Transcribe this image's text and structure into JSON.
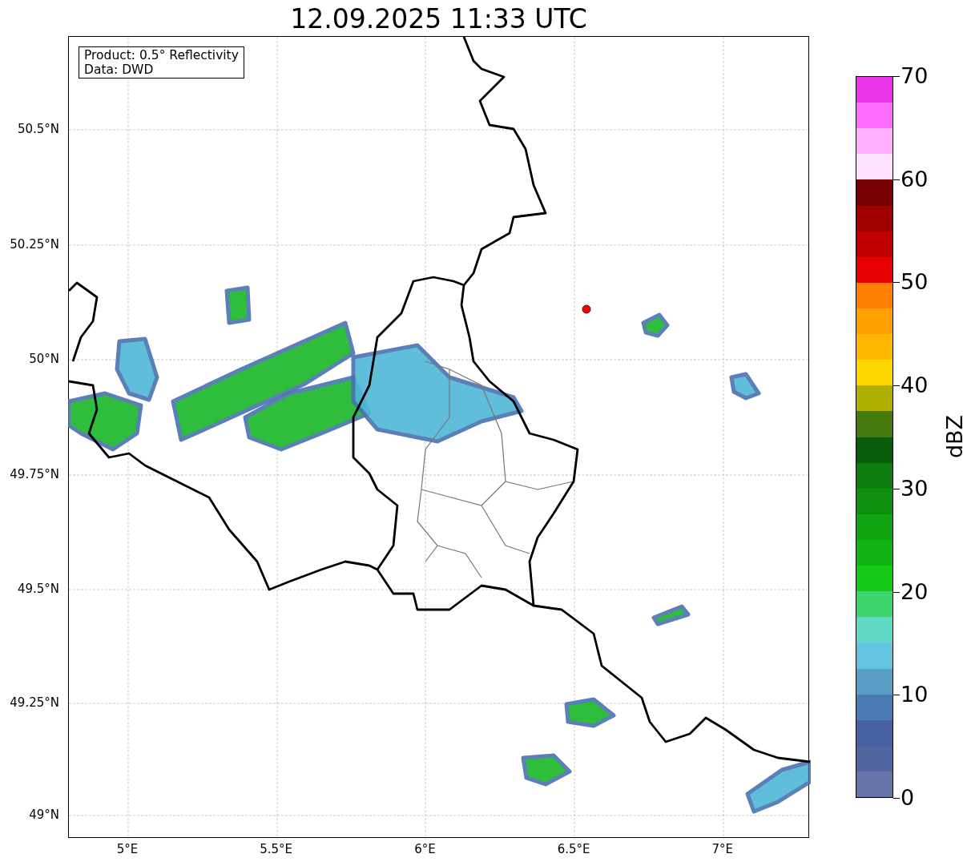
{
  "title": "12.09.2025 11:33 UTC",
  "map": {
    "legend": [
      "Product: 0.5° Reflectivity",
      "Data: DWD"
    ],
    "lat_labels": [
      "50.5°N",
      "50.25°N",
      "50°N",
      "49.75°N",
      "49.5°N",
      "49.25°N",
      "49°N"
    ],
    "lon_labels": [
      "5°E",
      "5.5°E",
      "6°E",
      "6.5°E",
      "7°E"
    ]
  },
  "colorbar": {
    "label": "dBZ",
    "ticks": [
      "70",
      "60",
      "50",
      "40",
      "30",
      "20",
      "10",
      "0"
    ],
    "bins": [
      {
        "color": "#ea36ea"
      },
      {
        "color": "#ff6cff"
      },
      {
        "color": "#ffb0ff"
      },
      {
        "color": "#ffe0ff"
      },
      {
        "color": "#780000"
      },
      {
        "color": "#a00000"
      },
      {
        "color": "#c00000"
      },
      {
        "color": "#e60000"
      },
      {
        "color": "#ff7f00"
      },
      {
        "color": "#ff9f00"
      },
      {
        "color": "#ffb700"
      },
      {
        "color": "#ffd700"
      },
      {
        "color": "#b0b000"
      },
      {
        "color": "#467a0c"
      },
      {
        "color": "#085c0a"
      },
      {
        "color": "#0c7c0e"
      },
      {
        "color": "#0e900e"
      },
      {
        "color": "#10a410"
      },
      {
        "color": "#12b414"
      },
      {
        "color": "#14c814"
      },
      {
        "color": "#3dd46c"
      },
      {
        "color": "#5fd8c4"
      },
      {
        "color": "#64c4df"
      },
      {
        "color": "#5a9ec8"
      },
      {
        "color": "#4a7ab3"
      },
      {
        "color": "#4660a3"
      },
      {
        "color": "#5166a0"
      },
      {
        "color": "#6473a8"
      }
    ]
  }
}
